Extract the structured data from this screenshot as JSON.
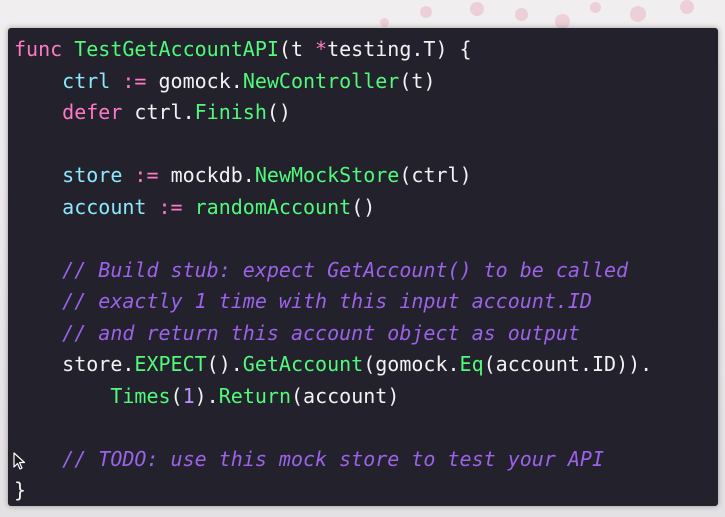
{
  "code_lines": [
    [
      {
        "t": "func ",
        "c": "kw"
      },
      {
        "t": "TestGetAccountAPI",
        "c": "fn"
      },
      {
        "t": "(t ",
        "c": "plain"
      },
      {
        "t": "*",
        "c": "op"
      },
      {
        "t": "testing.T) {",
        "c": "plain"
      }
    ],
    [
      {
        "t": "    ",
        "c": "plain"
      },
      {
        "t": "ctrl",
        "c": "var"
      },
      {
        "t": " := ",
        "c": "op"
      },
      {
        "t": "gomock.",
        "c": "plain"
      },
      {
        "t": "NewController",
        "c": "fn"
      },
      {
        "t": "(t)",
        "c": "plain"
      }
    ],
    [
      {
        "t": "    ",
        "c": "plain"
      },
      {
        "t": "defer ",
        "c": "kw"
      },
      {
        "t": "ctrl.",
        "c": "plain"
      },
      {
        "t": "Finish",
        "c": "fn"
      },
      {
        "t": "()",
        "c": "plain"
      }
    ],
    [
      {
        "t": "",
        "c": "plain"
      }
    ],
    [
      {
        "t": "    ",
        "c": "plain"
      },
      {
        "t": "store",
        "c": "var"
      },
      {
        "t": " := ",
        "c": "op"
      },
      {
        "t": "mockdb.",
        "c": "plain"
      },
      {
        "t": "NewMockStore",
        "c": "fn"
      },
      {
        "t": "(ctrl)",
        "c": "plain"
      }
    ],
    [
      {
        "t": "    ",
        "c": "plain"
      },
      {
        "t": "account",
        "c": "var"
      },
      {
        "t": " := ",
        "c": "op"
      },
      {
        "t": "randomAccount",
        "c": "fn"
      },
      {
        "t": "()",
        "c": "plain"
      }
    ],
    [
      {
        "t": "",
        "c": "plain"
      }
    ],
    [
      {
        "t": "    ",
        "c": "plain"
      },
      {
        "t": "// Build stub: expect GetAccount() to be called",
        "c": "cmt"
      }
    ],
    [
      {
        "t": "    ",
        "c": "plain"
      },
      {
        "t": "// exactly 1 time with this input account.ID",
        "c": "cmt"
      }
    ],
    [
      {
        "t": "    ",
        "c": "plain"
      },
      {
        "t": "// and return this account object as output",
        "c": "cmt"
      }
    ],
    [
      {
        "t": "    ",
        "c": "plain"
      },
      {
        "t": "store.",
        "c": "plain"
      },
      {
        "t": "EXPECT",
        "c": "fn"
      },
      {
        "t": "().",
        "c": "plain"
      },
      {
        "t": "GetAccount",
        "c": "fn"
      },
      {
        "t": "(gomock.",
        "c": "plain"
      },
      {
        "t": "Eq",
        "c": "fn"
      },
      {
        "t": "(account.ID)).",
        "c": "plain"
      }
    ],
    [
      {
        "t": "        ",
        "c": "plain"
      },
      {
        "t": "Times",
        "c": "fn"
      },
      {
        "t": "(",
        "c": "plain"
      },
      {
        "t": "1",
        "c": "num"
      },
      {
        "t": ").",
        "c": "plain"
      },
      {
        "t": "Return",
        "c": "fn"
      },
      {
        "t": "(account)",
        "c": "plain"
      }
    ],
    [
      {
        "t": "",
        "c": "plain"
      }
    ],
    [
      {
        "t": "    ",
        "c": "plain"
      },
      {
        "t": "// TODO: use this mock store to test your API",
        "c": "cmt"
      }
    ],
    [
      {
        "t": "}",
        "c": "plain"
      }
    ]
  ],
  "colors": {
    "editor_bg": "#22212c",
    "keyword": "#ff79c6",
    "function": "#50fa7b",
    "variable": "#8be9fd",
    "comment": "#9a63e8",
    "number": "#bd93f9",
    "text": "#f2f2f2"
  },
  "icons": {
    "pointer": "mouse-pointer-icon"
  }
}
